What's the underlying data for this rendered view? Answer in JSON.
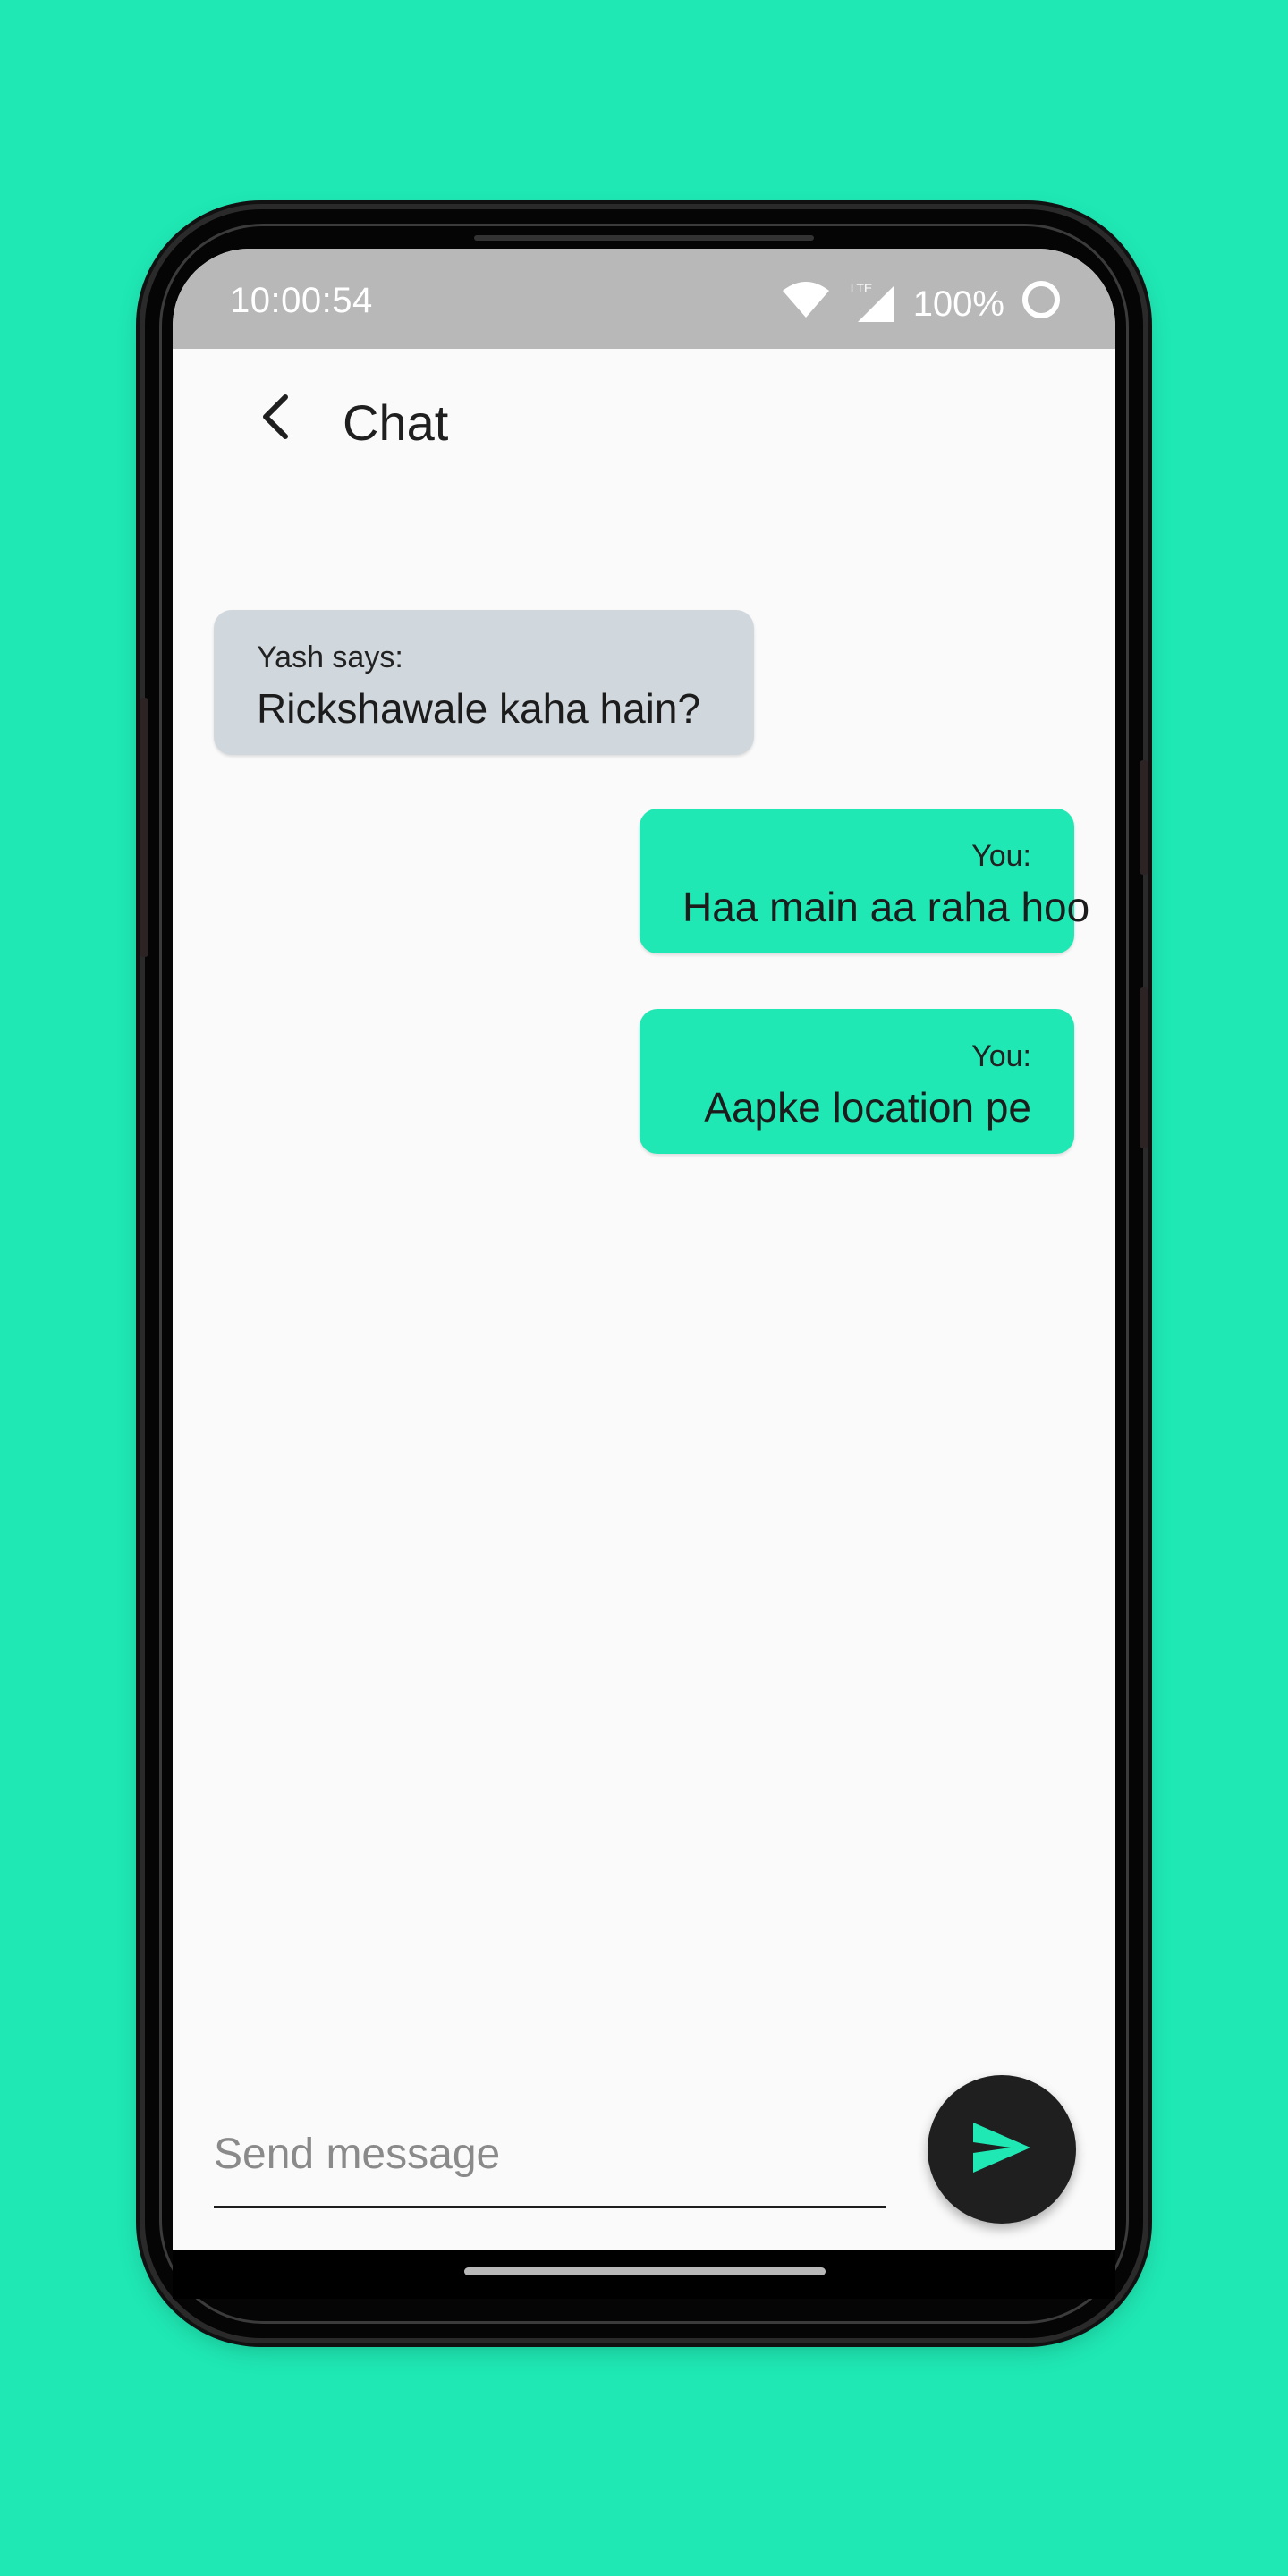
{
  "status_bar": {
    "time": "10:00:54",
    "network": "LTE",
    "battery": "100%"
  },
  "header": {
    "title": "Chat"
  },
  "messages": [
    {
      "sender": "Yash says:",
      "text": "Rickshawale kaha hain?",
      "direction": "incoming"
    },
    {
      "sender": "You:",
      "text": "Haa main aa raha hoo",
      "direction": "outgoing"
    },
    {
      "sender": "You:",
      "text": "Aapke location pe",
      "direction": "outgoing"
    }
  ],
  "composer": {
    "placeholder": "Send message",
    "value": ""
  },
  "icons": {
    "back": "arrow-back-icon",
    "send": "send-icon",
    "wifi": "wifi-icon",
    "signal": "signal-icon",
    "battery": "battery-icon"
  },
  "colors": {
    "accent": "#1fe8b4",
    "incoming_bubble": "#d1d8dd",
    "status_bar": "#b8b8b8",
    "fab": "#1f1f1f"
  }
}
